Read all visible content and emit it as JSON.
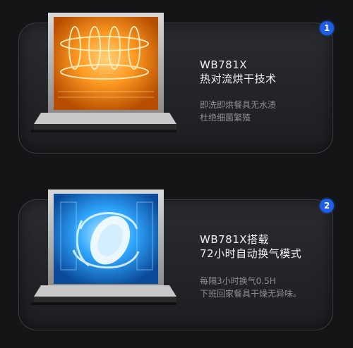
{
  "sections": [
    {
      "badge": "1",
      "title_line1": "WB781X",
      "title_line2": "热对流烘干技术",
      "desc_line1": "即洗即烘餐具无水渍",
      "desc_line2": "杜绝细菌繁殖",
      "illustration": "hot-air-drying-dishwasher"
    },
    {
      "badge": "2",
      "title_line1": "WB781X搭载",
      "title_line2": "72小时自动换气模式",
      "desc_line1": "每隔3小时换气0.5H",
      "desc_line2": "下班回家餐具干燥无异味。",
      "illustration": "auto-ventilation-dishwasher"
    }
  ],
  "colors": {
    "badge": "#1f5ee6",
    "heat_glow": "#ff8a1c",
    "ventilation_glow": "#2aa8ff",
    "panel_bg": "#222427"
  }
}
